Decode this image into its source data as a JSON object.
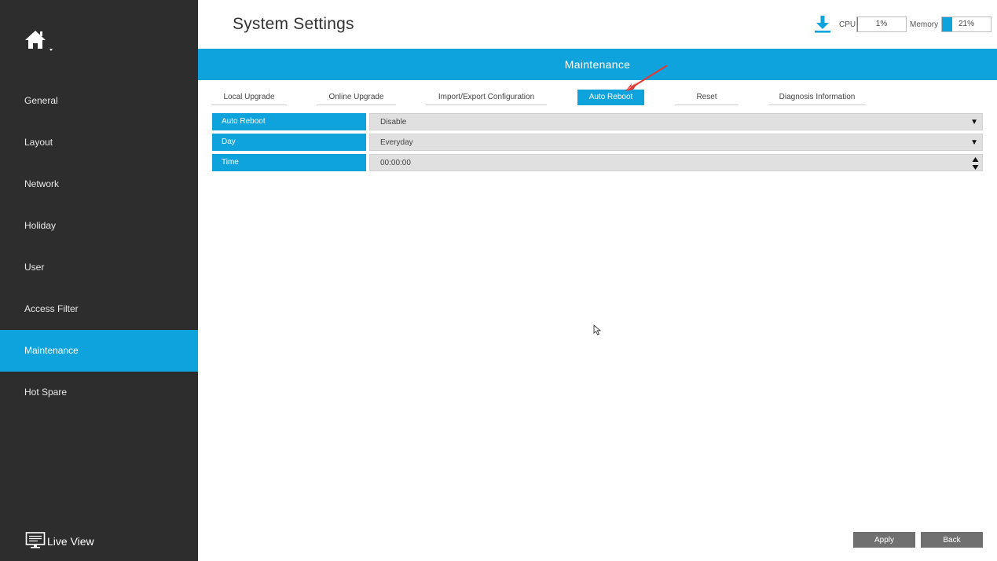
{
  "sidebar": {
    "items": [
      {
        "label": "General"
      },
      {
        "label": "Layout"
      },
      {
        "label": "Network"
      },
      {
        "label": "Holiday"
      },
      {
        "label": "User"
      },
      {
        "label": "Access Filter"
      },
      {
        "label": "Maintenance",
        "active": true
      },
      {
        "label": "Hot Spare"
      }
    ],
    "live_view_label": "Live View"
  },
  "header": {
    "title": "System Settings",
    "cpu_label": "CPU",
    "cpu_value": "1%",
    "cpu_percent": 1,
    "memory_label": "Memory",
    "memory_value": "21%",
    "memory_percent": 21
  },
  "banner": {
    "title": "Maintenance"
  },
  "tabs": [
    {
      "label": "Local Upgrade"
    },
    {
      "label": "Online Upgrade"
    },
    {
      "label": "Import/Export Configuration"
    },
    {
      "label": "Auto Reboot",
      "active": true
    },
    {
      "label": "Reset"
    },
    {
      "label": "Diagnosis Information"
    }
  ],
  "form": {
    "rows": [
      {
        "label": "Auto Reboot",
        "value": "Disable",
        "control": "select"
      },
      {
        "label": "Day",
        "value": "Everyday",
        "control": "select"
      },
      {
        "label": "Time",
        "value": "00:00:00",
        "control": "spinner"
      }
    ]
  },
  "buttons": {
    "apply": "Apply",
    "back": "Back"
  },
  "colors": {
    "accent": "#0ea3dc",
    "sidebar_bg": "#2d2d2d",
    "button_bg": "#707070",
    "annotation": "#e53935"
  },
  "icons": {
    "home": "home-icon",
    "download": "download-icon",
    "live_view": "monitor-icon",
    "dropdown": "caret-down-icon",
    "spinner": "spinner-arrows-icon"
  }
}
